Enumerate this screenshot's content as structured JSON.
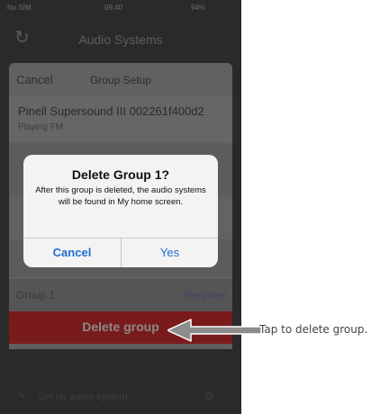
{
  "status_bar": {
    "carrier": "No SIM",
    "time": "09:40",
    "battery": "94%"
  },
  "nav": {
    "title": "Audio Systems",
    "refresh_icon": "refresh-icon"
  },
  "group_setup": {
    "cancel_label": "Cancel",
    "title": "Group Setup",
    "device_name": "Pinell Supersound III 002261f400d2",
    "device_status": "Playing FM",
    "group_name": "Group 1",
    "rename_label": "Rename",
    "delete_label": "Delete group"
  },
  "bottom": {
    "setup_label": "Set up audio system"
  },
  "dialog": {
    "title": "Delete Group 1?",
    "message": "After this group is deleted, the audio systems will be found in My home screen.",
    "cancel_label": "Cancel",
    "yes_label": "Yes"
  },
  "annotation": {
    "text": "Tap to delete group."
  },
  "colors": {
    "delete_red": "#c32a2a",
    "dialog_blue": "#1f6fd0",
    "rename_purple": "#7b61c9"
  }
}
